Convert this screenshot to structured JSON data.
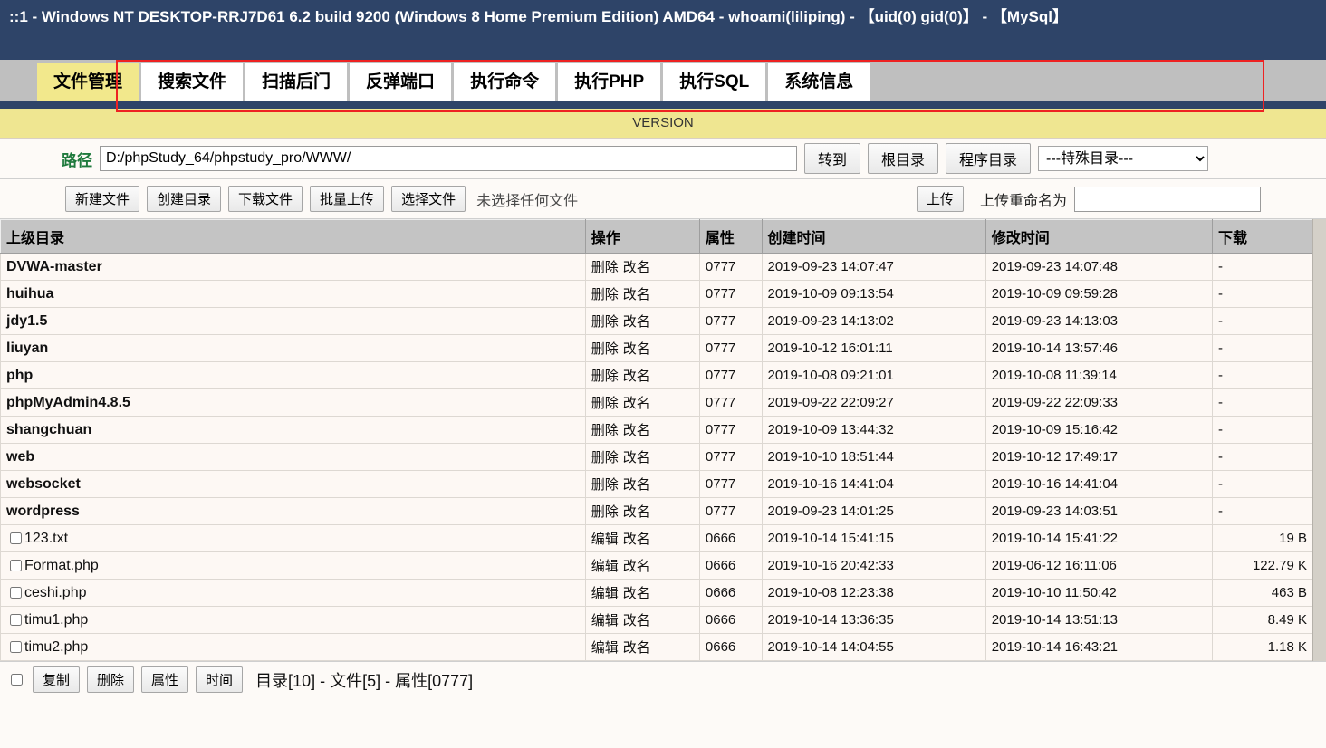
{
  "titlebar": {
    "text": "::1 - Windows NT DESKTOP-RRJ7D61 6.2 build 9200 (Windows 8 Home Premium Edition) AMD64 - whoami(liliping) - 【uid(0) gid(0)】 - 【MySql】"
  },
  "tabs": [
    {
      "label": "文件管理",
      "active": true
    },
    {
      "label": "搜索文件",
      "active": false
    },
    {
      "label": "扫描后门",
      "active": false
    },
    {
      "label": "反弹端口",
      "active": false
    },
    {
      "label": "执行命令",
      "active": false
    },
    {
      "label": "执行PHP",
      "active": false
    },
    {
      "label": "执行SQL",
      "active": false
    },
    {
      "label": "系统信息",
      "active": false
    }
  ],
  "version_bar": {
    "text": "VERSION"
  },
  "path_row": {
    "label": "路径",
    "value": "D:/phpStudy_64/phpstudy_pro/WWW/",
    "placeholder": "",
    "goto_label": "转到",
    "root_label": "根目录",
    "program_label": "程序目录",
    "special_selected": "---特殊目录---",
    "special_options": [
      "---特殊目录---"
    ]
  },
  "toolbar": {
    "new_file_label": "新建文件",
    "new_dir_label": "创建目录",
    "download_file_label": "下载文件",
    "batch_upload_label": "批量上传",
    "choose_file_label": "选择文件",
    "no_file_text": "未选择任何文件",
    "upload_label": "上传",
    "upload_rename_label": "上传重命名为",
    "upload_rename_value": "",
    "upload_rename_placeholder": ""
  },
  "table": {
    "headers": {
      "name": "上级目录",
      "op": "操作",
      "perm": "属性",
      "ctime": "创建时间",
      "mtime": "修改时间",
      "dl": "下载"
    },
    "rows": [
      {
        "type": "dir",
        "name": "DVWA-master",
        "op1": "删除",
        "op2": "改名",
        "perm": "0777",
        "ctime": "2019-09-23 14:07:47",
        "mtime": "2019-09-23 14:07:48",
        "dl": "-"
      },
      {
        "type": "dir",
        "name": "huihua",
        "op1": "删除",
        "op2": "改名",
        "perm": "0777",
        "ctime": "2019-10-09 09:13:54",
        "mtime": "2019-10-09 09:59:28",
        "dl": "-"
      },
      {
        "type": "dir",
        "name": "jdy1.5",
        "op1": "删除",
        "op2": "改名",
        "perm": "0777",
        "ctime": "2019-09-23 14:13:02",
        "mtime": "2019-09-23 14:13:03",
        "dl": "-"
      },
      {
        "type": "dir",
        "name": "liuyan",
        "op1": "删除",
        "op2": "改名",
        "perm": "0777",
        "ctime": "2019-10-12 16:01:11",
        "mtime": "2019-10-14 13:57:46",
        "dl": "-"
      },
      {
        "type": "dir",
        "name": "php",
        "op1": "删除",
        "op2": "改名",
        "perm": "0777",
        "ctime": "2019-10-08 09:21:01",
        "mtime": "2019-10-08 11:39:14",
        "dl": "-"
      },
      {
        "type": "dir",
        "name": "phpMyAdmin4.8.5",
        "op1": "删除",
        "op2": "改名",
        "perm": "0777",
        "ctime": "2019-09-22 22:09:27",
        "mtime": "2019-09-22 22:09:33",
        "dl": "-"
      },
      {
        "type": "dir",
        "name": "shangchuan",
        "op1": "删除",
        "op2": "改名",
        "perm": "0777",
        "ctime": "2019-10-09 13:44:32",
        "mtime": "2019-10-09 15:16:42",
        "dl": "-"
      },
      {
        "type": "dir",
        "name": "web",
        "op1": "删除",
        "op2": "改名",
        "perm": "0777",
        "ctime": "2019-10-10 18:51:44",
        "mtime": "2019-10-12 17:49:17",
        "dl": "-"
      },
      {
        "type": "dir",
        "name": "websocket",
        "op1": "删除",
        "op2": "改名",
        "perm": "0777",
        "ctime": "2019-10-16 14:41:04",
        "mtime": "2019-10-16 14:41:04",
        "dl": "-"
      },
      {
        "type": "dir",
        "name": "wordpress",
        "op1": "删除",
        "op2": "改名",
        "perm": "0777",
        "ctime": "2019-09-23 14:01:25",
        "mtime": "2019-09-23 14:03:51",
        "dl": "-"
      },
      {
        "type": "file",
        "name": "123.txt",
        "op1": "编辑",
        "op2": "改名",
        "perm": "0666",
        "ctime": "2019-10-14 15:41:15",
        "mtime": "2019-10-14 15:41:22",
        "dl": "19 B"
      },
      {
        "type": "file",
        "name": "Format.php",
        "op1": "编辑",
        "op2": "改名",
        "perm": "0666",
        "ctime": "2019-10-16 20:42:33",
        "mtime": "2019-06-12 16:11:06",
        "dl": "122.79 K"
      },
      {
        "type": "file",
        "name": "ceshi.php",
        "op1": "编辑",
        "op2": "改名",
        "perm": "0666",
        "ctime": "2019-10-08 12:23:38",
        "mtime": "2019-10-10 11:50:42",
        "dl": "463 B"
      },
      {
        "type": "file",
        "name": "timu1.php",
        "op1": "编辑",
        "op2": "改名",
        "perm": "0666",
        "ctime": "2019-10-14 13:36:35",
        "mtime": "2019-10-14 13:51:13",
        "dl": "8.49 K"
      },
      {
        "type": "file",
        "name": "timu2.php",
        "op1": "编辑",
        "op2": "改名",
        "perm": "0666",
        "ctime": "2019-10-14 14:04:55",
        "mtime": "2019-10-14 16:43:21",
        "dl": "1.18 K"
      }
    ]
  },
  "footer": {
    "copy_label": "复制",
    "delete_label": "删除",
    "perm_label": "属性",
    "time_label": "时间",
    "summary": "目录[10] - 文件[5] - 属性[0777]"
  },
  "colors": {
    "titlebar_bg": "#2e4468",
    "tab_active_bg": "#f2e88c",
    "version_bg": "#efe691",
    "highlight_border": "#ee2222",
    "path_label": "#1f7a3d"
  }
}
